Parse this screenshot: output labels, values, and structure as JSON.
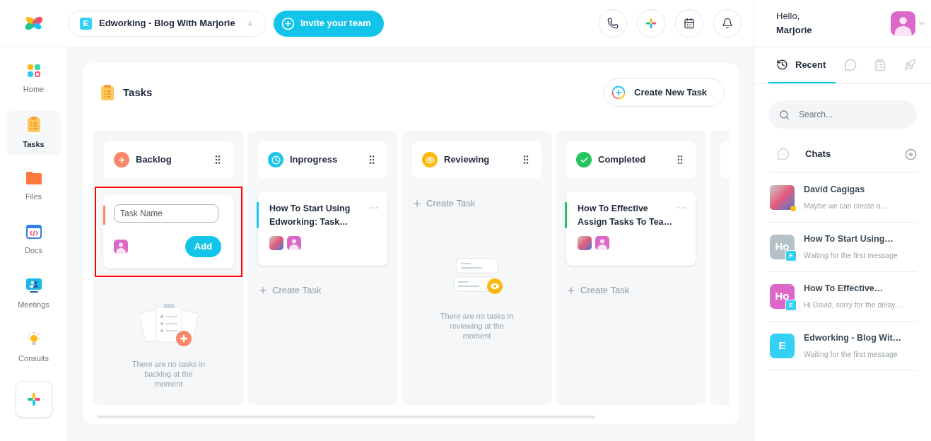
{
  "header": {
    "workspace": {
      "badge": "E",
      "name": "Edworking - Blog With Marjorie"
    },
    "invite_button": "Invite your team",
    "actions": [
      {
        "kind": "phone"
      },
      {
        "kind": "sparkle"
      },
      {
        "kind": "calendar"
      },
      {
        "kind": "bell"
      }
    ]
  },
  "sidebar": {
    "items": [
      {
        "kind": "home",
        "label": "Home",
        "selected": false
      },
      {
        "kind": "tasks",
        "label": "Tasks",
        "selected": true
      },
      {
        "kind": "files",
        "label": "Files",
        "selected": false
      },
      {
        "kind": "docs",
        "label": "Docs",
        "selected": false
      },
      {
        "kind": "meetings",
        "label": "Meetings",
        "selected": false
      },
      {
        "kind": "consults",
        "label": "Consults",
        "selected": false
      }
    ]
  },
  "board": {
    "title": "Tasks",
    "create_button": "Create New Task",
    "columns": [
      {
        "kind": "plus",
        "title": "Backlog",
        "color": "#f8876a",
        "new_task": {
          "placeholder": "Task Name",
          "button": "Add",
          "highlighted": true
        },
        "empty_text": "There are no tasks in backlog at the moment"
      },
      {
        "kind": "clock",
        "title": "Inprogress",
        "color": "#1cc5ec",
        "cards": [
          {
            "title": "How To Start Using Edworking: Task…"
          }
        ],
        "create_task": "Create Task"
      },
      {
        "kind": "eye",
        "title": "Reviewing",
        "color": "#fdb913",
        "create_task": "Create Task",
        "empty_text": "There are no tasks in reviewing at the moment"
      },
      {
        "kind": "check",
        "title": "Completed",
        "color": "#22c55e",
        "cards": [
          {
            "title": "How To Effective Assign Tasks To Tea…"
          }
        ],
        "create_task": "Create Task"
      }
    ]
  },
  "user": {
    "greeting": "Hello,",
    "name": "Marjorie"
  },
  "panel": {
    "tabs": [
      {
        "kind": "clock",
        "label": "Recent",
        "selected": true
      },
      {
        "kind": "chat",
        "selected": false
      },
      {
        "kind": "list",
        "selected": false
      },
      {
        "kind": "rocket",
        "selected": false
      }
    ],
    "search": {
      "placeholder": "Search..."
    },
    "chats_title": "Chats",
    "chats": [
      {
        "kind": "photo",
        "name": "David Cagigas",
        "preview": "Maybe we can create a…",
        "color": "#fdb913"
      },
      {
        "kind": "initials",
        "initials": "Ho",
        "badge": "E",
        "color": "#b4c1c7",
        "name": "How To Start Using…",
        "preview": "Waiting for the first message"
      },
      {
        "kind": "initials",
        "initials": "Ho",
        "badge": "E",
        "color": "#db68c9",
        "name": "How To Effective…",
        "preview": "Hi David, sorry for the delay.…"
      },
      {
        "kind": "letter",
        "initials": "E",
        "color": "#35d0f5",
        "name": "Edworking - Blog Wit…",
        "preview": "Waiting for the first message"
      }
    ]
  }
}
